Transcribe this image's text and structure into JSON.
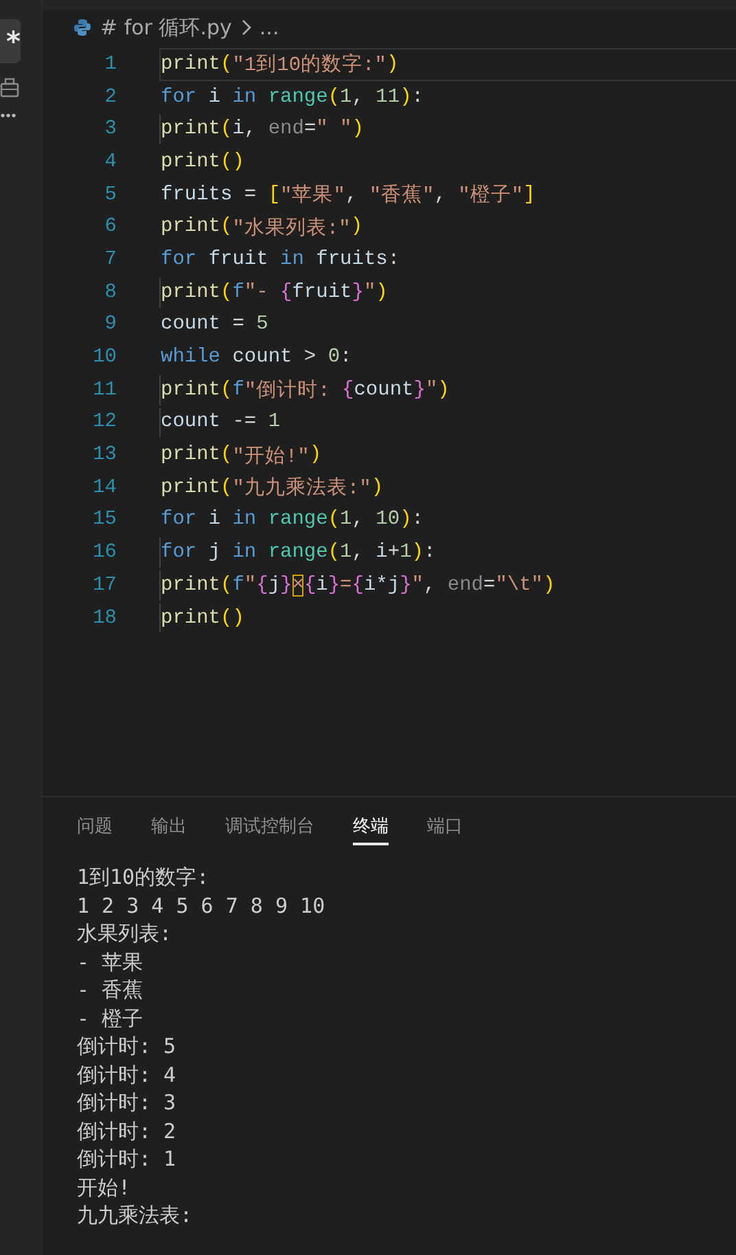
{
  "activity_bar": {
    "button_label": "*"
  },
  "breadcrumb": {
    "path": "# for 循环.py",
    "more": "..."
  },
  "editor": {
    "lines": [
      {
        "number": "1",
        "current": true,
        "tokens": [
          {
            "kind": "func",
            "text": "print"
          },
          {
            "kind": "paren",
            "text": "("
          },
          {
            "kind": "string",
            "text": "\"1到10的数字:\""
          },
          {
            "kind": "paren",
            "text": ")"
          }
        ]
      },
      {
        "number": "2",
        "current": false,
        "tokens": [
          {
            "kind": "keyword",
            "text": "for "
          },
          {
            "kind": "var",
            "text": "i "
          },
          {
            "kind": "keyword",
            "text": "in "
          },
          {
            "kind": "builtin",
            "text": "range"
          },
          {
            "kind": "paren",
            "text": "("
          },
          {
            "kind": "number",
            "text": "1"
          },
          {
            "kind": "plain",
            "text": ", "
          },
          {
            "kind": "number",
            "text": "11"
          },
          {
            "kind": "paren",
            "text": ")"
          },
          {
            "kind": "plain",
            "text": ":"
          }
        ]
      },
      {
        "number": "3",
        "current": false,
        "tokens": [
          {
            "kind": "func",
            "text": "    print"
          },
          {
            "kind": "paren",
            "text": "("
          },
          {
            "kind": "var",
            "text": "i"
          },
          {
            "kind": "plain",
            "text": ", "
          },
          {
            "kind": "param",
            "text": "end"
          },
          {
            "kind": "plain",
            "text": "="
          },
          {
            "kind": "string",
            "text": "\" \""
          },
          {
            "kind": "paren",
            "text": ")"
          }
        ]
      },
      {
        "number": "4",
        "current": false,
        "tokens": [
          {
            "kind": "func",
            "text": "print"
          },
          {
            "kind": "paren",
            "text": "()"
          }
        ]
      },
      {
        "number": "5",
        "current": false,
        "tokens": [
          {
            "kind": "var",
            "text": "fruits"
          },
          {
            "kind": "plain",
            "text": " = "
          },
          {
            "kind": "paren",
            "text": "["
          },
          {
            "kind": "string",
            "text": "\"苹果\""
          },
          {
            "kind": "plain",
            "text": ", "
          },
          {
            "kind": "string",
            "text": "\"香蕉\""
          },
          {
            "kind": "plain",
            "text": ", "
          },
          {
            "kind": "string",
            "text": "\"橙子\""
          },
          {
            "kind": "paren",
            "text": "]"
          }
        ]
      },
      {
        "number": "6",
        "current": false,
        "tokens": [
          {
            "kind": "func",
            "text": "print"
          },
          {
            "kind": "paren",
            "text": "("
          },
          {
            "kind": "string",
            "text": "\"水果列表:\""
          },
          {
            "kind": "paren",
            "text": ")"
          }
        ]
      },
      {
        "number": "7",
        "current": false,
        "tokens": [
          {
            "kind": "keyword",
            "text": "for "
          },
          {
            "kind": "var",
            "text": "fruit "
          },
          {
            "kind": "keyword",
            "text": "in "
          },
          {
            "kind": "var",
            "text": "fruits"
          },
          {
            "kind": "plain",
            "text": ":"
          }
        ]
      },
      {
        "number": "8",
        "current": false,
        "tokens": [
          {
            "kind": "func",
            "text": "    print"
          },
          {
            "kind": "paren",
            "text": "("
          },
          {
            "kind": "keyword",
            "text": "f"
          },
          {
            "kind": "string",
            "text": "\"- "
          },
          {
            "kind": "brace",
            "text": "{"
          },
          {
            "kind": "var",
            "text": "fruit"
          },
          {
            "kind": "brace",
            "text": "}"
          },
          {
            "kind": "string",
            "text": "\""
          },
          {
            "kind": "paren",
            "text": ")"
          }
        ]
      },
      {
        "number": "9",
        "current": false,
        "tokens": [
          {
            "kind": "var",
            "text": "count"
          },
          {
            "kind": "plain",
            "text": " = "
          },
          {
            "kind": "number",
            "text": "5"
          }
        ]
      },
      {
        "number": "10",
        "current": false,
        "tokens": [
          {
            "kind": "keyword",
            "text": "while "
          },
          {
            "kind": "var",
            "text": "count"
          },
          {
            "kind": "plain",
            "text": " > "
          },
          {
            "kind": "number",
            "text": "0"
          },
          {
            "kind": "plain",
            "text": ":"
          }
        ]
      },
      {
        "number": "11",
        "current": false,
        "tokens": [
          {
            "kind": "func",
            "text": "    print"
          },
          {
            "kind": "paren",
            "text": "("
          },
          {
            "kind": "keyword",
            "text": "f"
          },
          {
            "kind": "string",
            "text": "\"倒计时: "
          },
          {
            "kind": "brace",
            "text": "{"
          },
          {
            "kind": "var",
            "text": "count"
          },
          {
            "kind": "brace",
            "text": "}"
          },
          {
            "kind": "string",
            "text": "\""
          },
          {
            "kind": "paren",
            "text": ")"
          }
        ]
      },
      {
        "number": "12",
        "current": false,
        "tokens": [
          {
            "kind": "var",
            "text": "    count"
          },
          {
            "kind": "plain",
            "text": " -= "
          },
          {
            "kind": "number",
            "text": "1"
          }
        ]
      },
      {
        "number": "13",
        "current": false,
        "tokens": [
          {
            "kind": "func",
            "text": "print"
          },
          {
            "kind": "paren",
            "text": "("
          },
          {
            "kind": "string",
            "text": "\"开始!\""
          },
          {
            "kind": "paren",
            "text": ")"
          }
        ]
      },
      {
        "number": "14",
        "current": false,
        "tokens": [
          {
            "kind": "func",
            "text": "print"
          },
          {
            "kind": "paren",
            "text": "("
          },
          {
            "kind": "string",
            "text": "\"九九乘法表:\""
          },
          {
            "kind": "paren",
            "text": ")"
          }
        ]
      },
      {
        "number": "15",
        "current": false,
        "tokens": [
          {
            "kind": "keyword",
            "text": "for "
          },
          {
            "kind": "var",
            "text": "i "
          },
          {
            "kind": "keyword",
            "text": "in "
          },
          {
            "kind": "builtin",
            "text": "range"
          },
          {
            "kind": "paren",
            "text": "("
          },
          {
            "kind": "number",
            "text": "1"
          },
          {
            "kind": "plain",
            "text": ", "
          },
          {
            "kind": "number",
            "text": "10"
          },
          {
            "kind": "paren",
            "text": ")"
          },
          {
            "kind": "plain",
            "text": ":"
          }
        ]
      },
      {
        "number": "16",
        "current": false,
        "tokens": [
          {
            "kind": "keyword",
            "text": "    for "
          },
          {
            "kind": "var",
            "text": "j "
          },
          {
            "kind": "keyword",
            "text": "in "
          },
          {
            "kind": "builtin",
            "text": "range"
          },
          {
            "kind": "paren",
            "text": "("
          },
          {
            "kind": "number",
            "text": "1"
          },
          {
            "kind": "plain",
            "text": ", "
          },
          {
            "kind": "var",
            "text": "i"
          },
          {
            "kind": "plain",
            "text": "+"
          },
          {
            "kind": "number",
            "text": "1"
          },
          {
            "kind": "paren",
            "text": ")"
          },
          {
            "kind": "plain",
            "text": ":"
          }
        ]
      },
      {
        "number": "17",
        "current": false,
        "tokens": [
          {
            "kind": "func",
            "text": "        print"
          },
          {
            "kind": "paren",
            "text": "("
          },
          {
            "kind": "keyword",
            "text": "f"
          },
          {
            "kind": "string",
            "text": "\""
          },
          {
            "kind": "brace",
            "text": "{"
          },
          {
            "kind": "var",
            "text": "j"
          },
          {
            "kind": "brace",
            "text": "}"
          },
          {
            "kind": "flagged",
            "text": "×"
          },
          {
            "kind": "brace",
            "text": "{"
          },
          {
            "kind": "var",
            "text": "i"
          },
          {
            "kind": "brace",
            "text": "}"
          },
          {
            "kind": "string",
            "text": "="
          },
          {
            "kind": "brace",
            "text": "{"
          },
          {
            "kind": "var",
            "text": "i*j"
          },
          {
            "kind": "brace",
            "text": "}"
          },
          {
            "kind": "string",
            "text": "\""
          },
          {
            "kind": "plain",
            "text": ", "
          },
          {
            "kind": "param",
            "text": "end"
          },
          {
            "kind": "plain",
            "text": "="
          },
          {
            "kind": "string",
            "text": "\"\\t\""
          },
          {
            "kind": "paren",
            "text": ")"
          }
        ]
      },
      {
        "number": "18",
        "current": false,
        "tokens": [
          {
            "kind": "func",
            "text": "    print"
          },
          {
            "kind": "paren",
            "text": "()"
          }
        ]
      }
    ]
  },
  "panel": {
    "tabs": [
      {
        "label": "问题",
        "selected": false
      },
      {
        "label": "输出",
        "selected": false
      },
      {
        "label": "调试控制台",
        "selected": false
      },
      {
        "label": "终端",
        "selected": true
      },
      {
        "label": "端口",
        "selected": false
      }
    ],
    "terminal_lines": [
      "1到10的数字:",
      "1 2 3 4 5 6 7 8 9 10",
      "水果列表:",
      "- 苹果",
      "- 香蕉",
      "- 橙子",
      "倒计时: 5",
      "倒计时: 4",
      "倒计时: 3",
      "倒计时: 2",
      "倒计时: 1",
      "开始!",
      "九九乘法表:"
    ]
  }
}
